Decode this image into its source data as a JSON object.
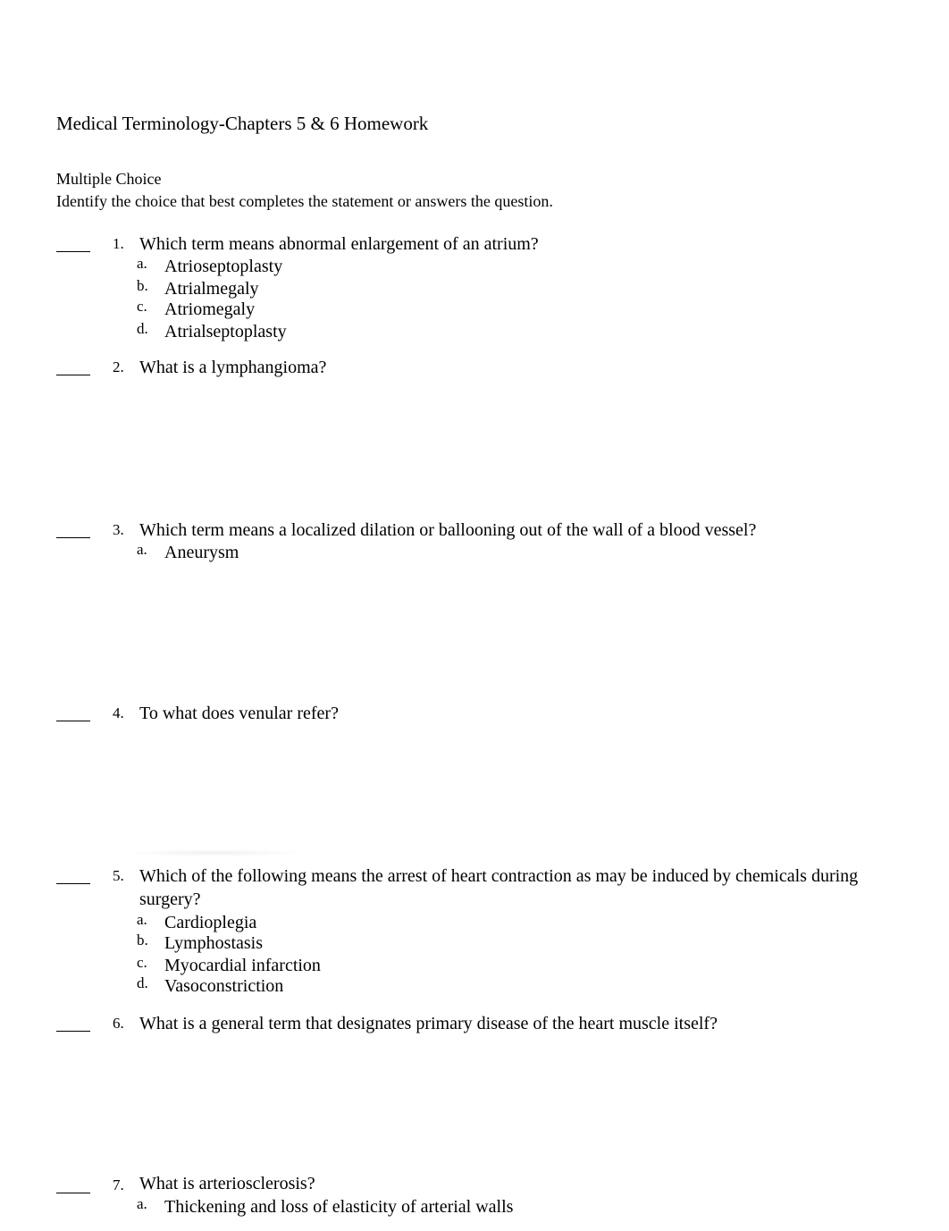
{
  "document": {
    "title": "Medical Terminology-Chapters 5 & 6 Homework",
    "section_heading": "Multiple Choice",
    "instructions": "Identify the choice that best completes the statement or answers the question.",
    "answer_blank": "____"
  },
  "questions": [
    {
      "number": "1.",
      "text": "Which term means abnormal enlargement of an atrium?",
      "options": [
        {
          "letter": "a.",
          "text": "Atrioseptoplasty"
        },
        {
          "letter": "b.",
          "text": "Atrialmegaly"
        },
        {
          "letter": "c.",
          "text": "Atriomegaly"
        },
        {
          "letter": "d.",
          "text": "Atrialseptoplasty"
        }
      ]
    },
    {
      "number": "2.",
      "text": "What is a lymphangioma?",
      "options": []
    },
    {
      "number": "3.",
      "text": "Which term means a localized dilation or ballooning out of the wall of a blood vessel?",
      "options": [
        {
          "letter": "a.",
          "text": "Aneurysm"
        }
      ]
    },
    {
      "number": "4.",
      "text": "To what does venular refer?",
      "options": []
    },
    {
      "number": "5.",
      "text": "Which of the following means the arrest of heart contraction as may be induced by chemicals during surgery?",
      "options": [
        {
          "letter": "a.",
          "text": "Cardioplegia"
        },
        {
          "letter": "b.",
          "text": "Lymphostasis"
        },
        {
          "letter": "c.",
          "text": "Myocardial infarction"
        },
        {
          "letter": "d.",
          "text": "Vasoconstriction"
        }
      ]
    },
    {
      "number": "6.",
      "text": "What is a general term that designates primary disease of the heart muscle itself?",
      "options": []
    },
    {
      "number": "7.",
      "text": "What is arteriosclerosis?",
      "options": [
        {
          "letter": "a.",
          "text": "Thickening and loss of elasticity of arterial walls"
        }
      ]
    }
  ]
}
